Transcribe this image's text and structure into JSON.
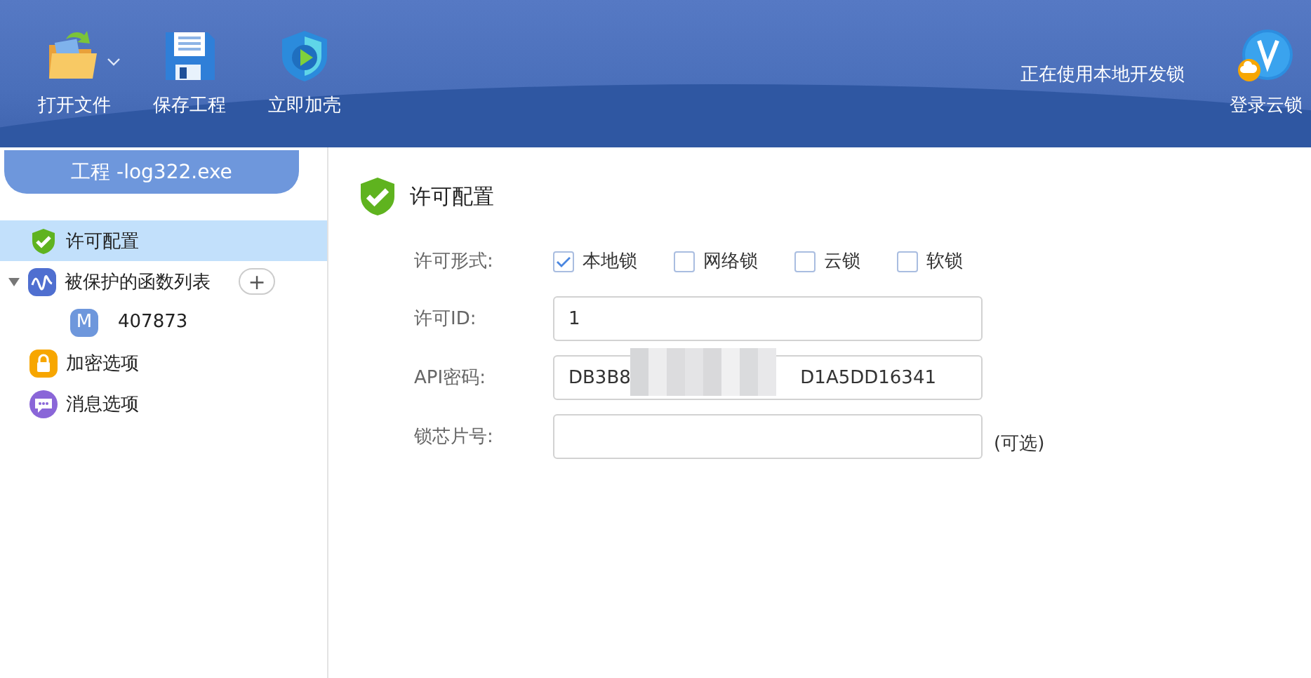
{
  "toolbar": {
    "buttons": [
      {
        "label": "打开文件",
        "kind": "open",
        "dropdown": true
      },
      {
        "label": "保存工程",
        "kind": "save",
        "dropdown": false
      },
      {
        "label": "立即加壳",
        "kind": "protect",
        "dropdown": false
      }
    ],
    "status": "正在使用本地开发锁",
    "login": "登录云锁"
  },
  "sidebar": {
    "project_tab": "工程 -log322.exe",
    "items": [
      {
        "label": "许可配置",
        "kind": "license",
        "selected": true
      },
      {
        "label": "被保护的函数列表",
        "kind": "functions",
        "selected": false,
        "expanded": true,
        "add_button": "+",
        "children": [
          {
            "badge": "M",
            "label": "407873",
            "selected": false
          }
        ]
      },
      {
        "label": "加密选项",
        "kind": "encrypt",
        "selected": false
      },
      {
        "label": "消息选项",
        "kind": "message",
        "selected": false
      }
    ]
  },
  "panel": {
    "title": "许可配置",
    "license_type": {
      "label": "许可形式:",
      "options": [
        {
          "label": "本地锁",
          "checked": true
        },
        {
          "label": "网络锁",
          "checked": false
        },
        {
          "label": "云锁",
          "checked": false
        },
        {
          "label": "软锁",
          "checked": false
        }
      ]
    },
    "fields": [
      {
        "label": "许可ID:",
        "value": "1"
      },
      {
        "label": "API密码:",
        "value_parts": [
          "DB3B8",
          "D1A5DD16341"
        ],
        "redacted": true
      },
      {
        "label": "锁芯片号:",
        "note": "(可选)"
      }
    ]
  }
}
